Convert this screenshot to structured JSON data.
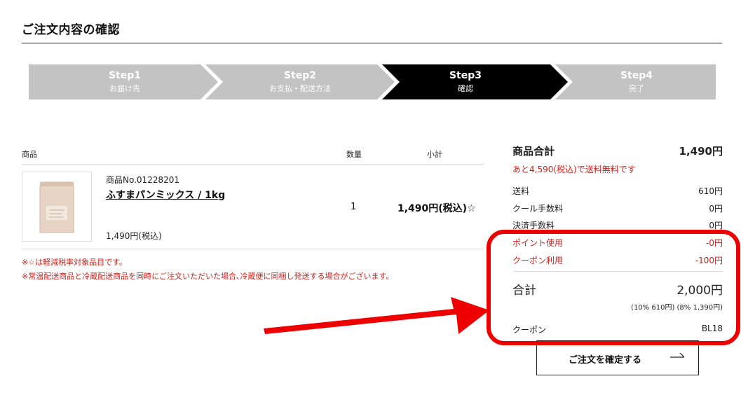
{
  "page": {
    "title": "ご注文内容の確認"
  },
  "steps": [
    {
      "name": "Step1",
      "sub": "お届け先",
      "state": "done"
    },
    {
      "name": "Step2",
      "sub": "お支払・配送方法",
      "state": "done"
    },
    {
      "name": "Step3",
      "sub": "確認",
      "state": "current"
    },
    {
      "name": "Step4",
      "sub": "完了",
      "state": "todo"
    }
  ],
  "colors": {
    "step_inactive": "#c3c3c3",
    "step_active": "#000000",
    "accent_red": "#d0201a",
    "annotation_red": "#ee0000"
  },
  "table": {
    "headers": {
      "product": "商品",
      "qty": "数量",
      "subtotal": "小計"
    },
    "items": [
      {
        "sku": "商品No.01228201",
        "name": "ふすまパンミックス / 1kg",
        "unit_price": "1,490円(税込)",
        "qty": "1",
        "subtotal": "1,490円(税込)☆"
      }
    ]
  },
  "notes": [
    "※☆は軽減税率対象品目です。",
    "※常温配送商品と冷蔵配送商品を同時にご注文いただいた場合､冷蔵便に同梱し発送する場合がございます。"
  ],
  "summary": {
    "product_total_label": "商品合計",
    "product_total": "1,490円",
    "free_shipping_notice": "あと4,590(税込)で送料無料です",
    "shipping_label": "送料",
    "shipping": "610円",
    "cool_fee_label": "クール手数料",
    "cool_fee": "0円",
    "payment_fee_label": "決済手数料",
    "payment_fee": "0円",
    "points_label": "ポイント使用",
    "points": "-0円",
    "coupon_use_label": "クーポン利用",
    "coupon_use": "-100円",
    "total_label": "合計",
    "total": "2,000円",
    "tax_breakdown": "(10% 610円) (8% 1,390円)",
    "coupon_label": "クーポン",
    "coupon_code": "BL18"
  },
  "confirm_button": {
    "label": "ご注文を確定する"
  }
}
